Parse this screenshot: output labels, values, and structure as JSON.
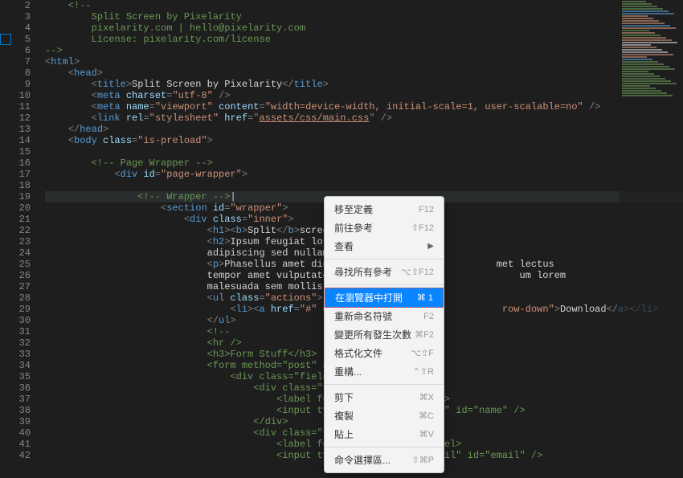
{
  "gutter": {
    "start": 2,
    "end": 42
  },
  "highlightedLine": 19,
  "markerLine": 4,
  "code": [
    {
      "i": 0,
      "tokens": [
        [
          "c-punct",
          "    "
        ],
        [
          "c-comment",
          "<!--"
        ]
      ]
    },
    {
      "i": 4,
      "tokens": [
        [
          "c-comment",
          "    Split Screen by Pixelarity"
        ]
      ]
    },
    {
      "i": 4,
      "tokens": [
        [
          "c-comment",
          "    pixelarity.com | hello@pixelarity.com"
        ]
      ]
    },
    {
      "i": 4,
      "tokens": [
        [
          "c-comment",
          "    License: pixelarity.com/license"
        ]
      ]
    },
    {
      "i": 0,
      "tokens": [
        [
          "c-comment",
          "-->"
        ]
      ]
    },
    {
      "i": 0,
      "tokens": [
        [
          "c-punct",
          "<"
        ],
        [
          "c-tag",
          "html"
        ],
        [
          "c-punct",
          ">"
        ]
      ]
    },
    {
      "i": 4,
      "tokens": [
        [
          "c-punct",
          "<"
        ],
        [
          "c-tag",
          "head"
        ],
        [
          "c-punct",
          ">"
        ]
      ]
    },
    {
      "i": 8,
      "tokens": [
        [
          "c-punct",
          "<"
        ],
        [
          "c-tag",
          "title"
        ],
        [
          "c-punct",
          ">"
        ],
        [
          "c-text",
          "Split Screen by Pixelarity"
        ],
        [
          "c-punct",
          "</"
        ],
        [
          "c-tag",
          "title"
        ],
        [
          "c-punct",
          ">"
        ]
      ]
    },
    {
      "i": 8,
      "tokens": [
        [
          "c-punct",
          "<"
        ],
        [
          "c-tag",
          "meta"
        ],
        [
          "c-text",
          " "
        ],
        [
          "c-attr",
          "charset"
        ],
        [
          "c-punct",
          "="
        ],
        [
          "c-string",
          "\"utf-8\""
        ],
        [
          "c-text",
          " "
        ],
        [
          "c-punct",
          "/>"
        ]
      ]
    },
    {
      "i": 8,
      "tokens": [
        [
          "c-punct",
          "<"
        ],
        [
          "c-tag",
          "meta"
        ],
        [
          "c-text",
          " "
        ],
        [
          "c-attr",
          "name"
        ],
        [
          "c-punct",
          "="
        ],
        [
          "c-string",
          "\"viewport\""
        ],
        [
          "c-text",
          " "
        ],
        [
          "c-attr",
          "content"
        ],
        [
          "c-punct",
          "="
        ],
        [
          "c-string",
          "\"width=device-width, initial-scale=1, user-scalable=no\""
        ],
        [
          "c-text",
          " "
        ],
        [
          "c-punct",
          "/>"
        ]
      ]
    },
    {
      "i": 8,
      "tokens": [
        [
          "c-punct",
          "<"
        ],
        [
          "c-tag",
          "link"
        ],
        [
          "c-text",
          " "
        ],
        [
          "c-attr",
          "rel"
        ],
        [
          "c-punct",
          "="
        ],
        [
          "c-string",
          "\"stylesheet\""
        ],
        [
          "c-text",
          " "
        ],
        [
          "c-attr",
          "href"
        ],
        [
          "c-punct",
          "=\""
        ],
        [
          "c-link",
          "assets/css/main.css"
        ],
        [
          "c-punct",
          "\" />"
        ]
      ]
    },
    {
      "i": 4,
      "tokens": [
        [
          "c-punct",
          "</"
        ],
        [
          "c-tag",
          "head"
        ],
        [
          "c-punct",
          ">"
        ]
      ]
    },
    {
      "i": 4,
      "tokens": [
        [
          "c-punct",
          "<"
        ],
        [
          "c-tag",
          "body"
        ],
        [
          "c-text",
          " "
        ],
        [
          "c-attr",
          "class"
        ],
        [
          "c-punct",
          "="
        ],
        [
          "c-string",
          "\"is-preload\""
        ],
        [
          "c-punct",
          ">"
        ]
      ]
    },
    {
      "i": 0,
      "tokens": [
        [
          "c-text",
          ""
        ]
      ]
    },
    {
      "i": 8,
      "tokens": [
        [
          "c-comment",
          "<!-- Page Wrapper -->"
        ]
      ]
    },
    {
      "i": 12,
      "tokens": [
        [
          "c-punct",
          "<"
        ],
        [
          "c-tag",
          "div"
        ],
        [
          "c-text",
          " "
        ],
        [
          "c-attr",
          "id"
        ],
        [
          "c-punct",
          "="
        ],
        [
          "c-string",
          "\"page-wrapper\""
        ],
        [
          "c-punct",
          ">"
        ]
      ]
    },
    {
      "i": 0,
      "tokens": [
        [
          "c-text",
          ""
        ]
      ]
    },
    {
      "i": 16,
      "tokens": [
        [
          "c-comment",
          "<!-- Wrapper -->"
        ],
        [
          "c-text",
          "|"
        ]
      ]
    },
    {
      "i": 20,
      "tokens": [
        [
          "c-punct",
          "<"
        ],
        [
          "c-tag",
          "section"
        ],
        [
          "c-text",
          " "
        ],
        [
          "c-attr",
          "id"
        ],
        [
          "c-punct",
          "="
        ],
        [
          "c-string",
          "\"wrapper\""
        ],
        [
          "c-punct",
          ">"
        ]
      ]
    },
    {
      "i": 24,
      "tokens": [
        [
          "c-punct",
          "<"
        ],
        [
          "c-tag",
          "div"
        ],
        [
          "c-text",
          " "
        ],
        [
          "c-attr",
          "class"
        ],
        [
          "c-punct",
          "="
        ],
        [
          "c-string",
          "\"inner\""
        ],
        [
          "c-punct",
          ">"
        ]
      ]
    },
    {
      "i": 28,
      "tokens": [
        [
          "c-punct",
          "<"
        ],
        [
          "c-tag",
          "h1"
        ],
        [
          "c-punct",
          "><"
        ],
        [
          "c-tag",
          "b"
        ],
        [
          "c-punct",
          ">"
        ],
        [
          "c-text",
          "Split"
        ],
        [
          "c-punct",
          "</"
        ],
        [
          "c-tag",
          "b"
        ],
        [
          "c-punct",
          ">"
        ],
        [
          "c-text",
          "screen"
        ],
        [
          "c-punct",
          "</"
        ],
        [
          "c-tag",
          "h1"
        ],
        [
          "c-punct",
          ">"
        ]
      ]
    },
    {
      "i": 28,
      "tokens": [
        [
          "c-punct",
          "<"
        ],
        [
          "c-tag",
          "h2"
        ],
        [
          "c-punct",
          ">"
        ],
        [
          "c-text",
          "Ipsum feugiat lorem tempus"
        ]
      ]
    },
    {
      "i": 28,
      "tokens": [
        [
          "c-text",
          "adipiscing sed nullam"
        ],
        [
          "c-punct",
          "</"
        ],
        [
          "c-tag",
          "h2"
        ],
        [
          "c-punct",
          ">"
        ]
      ]
    },
    {
      "i": 28,
      "tokens": [
        [
          "c-punct",
          "<"
        ],
        [
          "c-tag",
          "p"
        ],
        [
          "c-punct",
          ">"
        ],
        [
          "c-text",
          "Phasellus amet dignissim ma                    met lectus"
        ]
      ]
    },
    {
      "i": 28,
      "tokens": [
        [
          "c-text",
          "tempor amet vulputate et proin                        um lorem"
        ]
      ]
    },
    {
      "i": 28,
      "tokens": [
        [
          "c-text",
          "malesuada sem mollis elementum"
        ]
      ]
    },
    {
      "i": 28,
      "tokens": [
        [
          "c-punct",
          "<"
        ],
        [
          "c-tag",
          "ul"
        ],
        [
          "c-text",
          " "
        ],
        [
          "c-attr",
          "class"
        ],
        [
          "c-punct",
          "="
        ],
        [
          "c-string",
          "\"actions\""
        ],
        [
          "c-punct",
          ">"
        ]
      ]
    },
    {
      "i": 32,
      "tokens": [
        [
          "c-punct",
          "<"
        ],
        [
          "c-tag",
          "li"
        ],
        [
          "c-punct",
          "><"
        ],
        [
          "c-tag",
          "a"
        ],
        [
          "c-text",
          " "
        ],
        [
          "c-attr",
          "href"
        ],
        [
          "c-punct",
          "="
        ],
        [
          "c-string",
          "\"#\""
        ],
        [
          "c-text",
          " "
        ],
        [
          "c-attr",
          "class"
        ],
        [
          "c-punct",
          "="
        ],
        [
          "c-string",
          "\"but                     row-down\""
        ],
        [
          "c-punct",
          ">"
        ],
        [
          "c-text",
          "Download"
        ],
        [
          "c-punct",
          "</"
        ],
        [
          "c-tag",
          "a"
        ],
        [
          "c-punct",
          "></"
        ],
        [
          "c-tag",
          "li"
        ],
        [
          "c-punct",
          ">"
        ]
      ]
    },
    {
      "i": 28,
      "tokens": [
        [
          "c-punct",
          "</"
        ],
        [
          "c-tag",
          "ul"
        ],
        [
          "c-punct",
          ">"
        ]
      ]
    },
    {
      "i": 28,
      "tokens": [
        [
          "c-comment",
          "<!--"
        ]
      ]
    },
    {
      "i": 28,
      "tokens": [
        [
          "c-comment",
          "<hr />"
        ]
      ]
    },
    {
      "i": 28,
      "tokens": [
        [
          "c-comment",
          "<h3>Form Stuff</h3>"
        ]
      ]
    },
    {
      "i": 28,
      "tokens": [
        [
          "c-comment",
          "<form method=\"post\" action=\"#\">"
        ]
      ]
    },
    {
      "i": 32,
      "tokens": [
        [
          "c-comment",
          "<div class=\"fields\">"
        ]
      ]
    },
    {
      "i": 36,
      "tokens": [
        [
          "c-comment",
          "<div class=\"field half\">"
        ]
      ]
    },
    {
      "i": 40,
      "tokens": [
        [
          "c-comment",
          "<label for=\"name\">Name</label>"
        ]
      ]
    },
    {
      "i": 40,
      "tokens": [
        [
          "c-comment",
          "<input type=\"text\" name=\"name\" id=\"name\" />"
        ]
      ]
    },
    {
      "i": 36,
      "tokens": [
        [
          "c-comment",
          "</div>"
        ]
      ]
    },
    {
      "i": 36,
      "tokens": [
        [
          "c-comment",
          "<div class=\"field half\">"
        ]
      ]
    },
    {
      "i": 40,
      "tokens": [
        [
          "c-comment",
          "<label for=\"email\">Email</label>"
        ]
      ]
    },
    {
      "i": 40,
      "tokens": [
        [
          "c-comment",
          "<input type=\"email\" name=\"email\" id=\"email\" />"
        ]
      ]
    }
  ],
  "contextMenu": {
    "items": [
      {
        "label": "移至定義",
        "shortcut": "F12"
      },
      {
        "label": "前往參考",
        "shortcut": "⇧F12"
      },
      {
        "label": "查看",
        "chevron": true
      },
      {
        "sep": true
      },
      {
        "label": "尋找所有參考",
        "shortcut": "⌥⇧F12"
      },
      {
        "sep": true
      },
      {
        "label": "在瀏覽器中打開",
        "shortcut": "⌘ 1",
        "selected": true
      },
      {
        "label": "重新命名符號",
        "shortcut": "F2"
      },
      {
        "label": "變更所有發生次數",
        "shortcut": "⌘F2"
      },
      {
        "label": "格式化文件",
        "shortcut": "⌥⇧F"
      },
      {
        "label": "重構...",
        "shortcut": "⌃⇧R"
      },
      {
        "sep": true
      },
      {
        "label": "剪下",
        "shortcut": "⌘X"
      },
      {
        "label": "複製",
        "shortcut": "⌘C"
      },
      {
        "label": "貼上",
        "shortcut": "⌘V"
      },
      {
        "sep": true
      },
      {
        "label": "命令選擇區...",
        "shortcut": "⇧⌘P"
      }
    ]
  },
  "minimapColors": [
    "#6a9955",
    "#6a9955",
    "#6a9955",
    "#6a9955",
    "#569cd6",
    "#569cd6",
    "#ce9178",
    "#ce9178",
    "#ce9178",
    "#ce9178",
    "#569cd6",
    "#ce9178",
    "#6a9955",
    "#ce9178",
    "#6a9955",
    "#ce9178",
    "#ce9178",
    "#d4d4d4",
    "#d4d4d4",
    "#ce9178",
    "#d4d4d4",
    "#d4d4d4",
    "#ce9178",
    "#ce9178",
    "#569cd6",
    "#6a9955",
    "#6a9955",
    "#6a9955",
    "#6a9955",
    "#6a9955",
    "#6a9955",
    "#6a9955",
    "#6a9955",
    "#6a9955",
    "#6a9955",
    "#6a9955",
    "#6a9955",
    "#6a9955",
    "#6a9955",
    "#6a9955"
  ]
}
